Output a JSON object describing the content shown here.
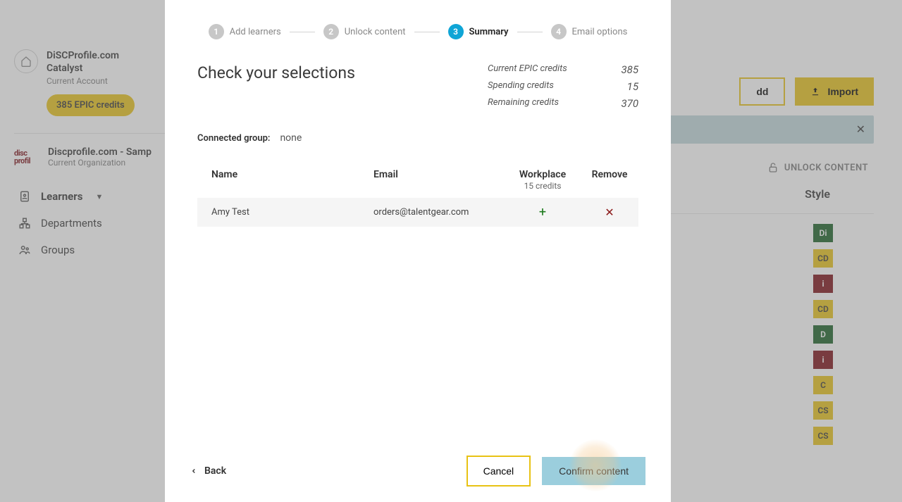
{
  "account": {
    "title_line1": "DiSCProfile.com",
    "title_line2": "Catalyst",
    "subtitle": "Current Account",
    "credits_pill": "385 EPIC credits"
  },
  "organization": {
    "logo_text": "disc profil",
    "title": "Discprofile.com - Samp",
    "subtitle": "Current Organization"
  },
  "nav": {
    "learners": "Learners",
    "departments": "Departments",
    "groups": "Groups"
  },
  "toolbar": {
    "add": "dd",
    "import": "Import",
    "unlock": "UNLOCK CONTENT",
    "style_header": "Style"
  },
  "style_rows": [
    "Di",
    "CD",
    "i",
    "CD",
    "D",
    "i",
    "C",
    "CS",
    "CS"
  ],
  "stepper": {
    "s1": "Add learners",
    "s2": "Unlock content",
    "s3": "Summary",
    "s4": "Email options"
  },
  "modal": {
    "title": "Check your selections",
    "credits": {
      "current_label": "Current EPIC credits",
      "current_val": "385",
      "spending_label": "Spending credits",
      "spending_val": "15",
      "remaining_label": "Remaining credits",
      "remaining_val": "370"
    },
    "group_label": "Connected group:",
    "group_value": "none",
    "table": {
      "name_h": "Name",
      "email_h": "Email",
      "workplace_h": "Workplace",
      "workplace_sub": "15 credits",
      "remove_h": "Remove",
      "rows": [
        {
          "name": "Amy Test",
          "email": "orders@talentgear.com"
        }
      ]
    },
    "back": "Back",
    "cancel": "Cancel",
    "confirm": "Confirm content"
  }
}
